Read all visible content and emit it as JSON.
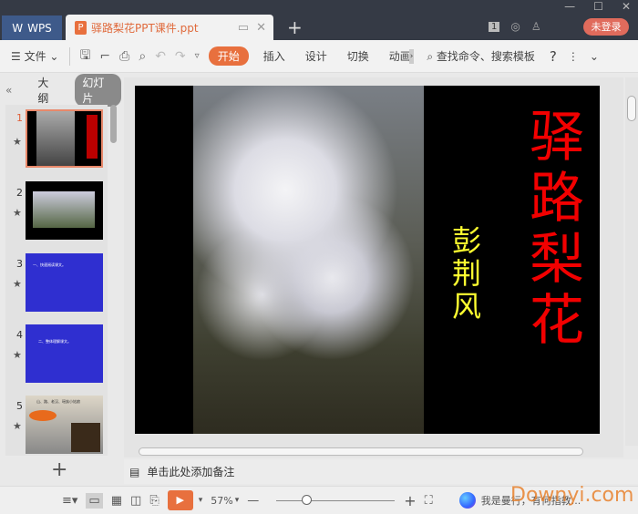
{
  "titlebar": {
    "wps_label": "WPS",
    "doc_tab": "驿路梨花PPT课件.ppt",
    "ppt_icon": "P",
    "badge": "1",
    "login": "未登录"
  },
  "toolbar": {
    "file": "文件",
    "menus": [
      "开始",
      "插入",
      "设计",
      "切换",
      "动画"
    ],
    "search": "查找命令、搜索模板",
    "help": "?"
  },
  "left_panel": {
    "outline_tab": "大纲",
    "slides_tab": "幻灯片",
    "slides": [
      {
        "num": "1",
        "text": ""
      },
      {
        "num": "2",
        "text": ""
      },
      {
        "num": "3",
        "text": "一、快速阅读课文。"
      },
      {
        "num": "4",
        "text": "二、整体理解课文。"
      },
      {
        "num": "5",
        "text": "山、路、老汉、瑶族小姑娘"
      }
    ]
  },
  "slide": {
    "title": "驿路梨花",
    "author": "彭荆风"
  },
  "notes": {
    "placeholder": "单击此处添加备注"
  },
  "status": {
    "zoom": "57%",
    "assistant": "我是曼行，有何指教..."
  },
  "watermark": "Downyi.com"
}
